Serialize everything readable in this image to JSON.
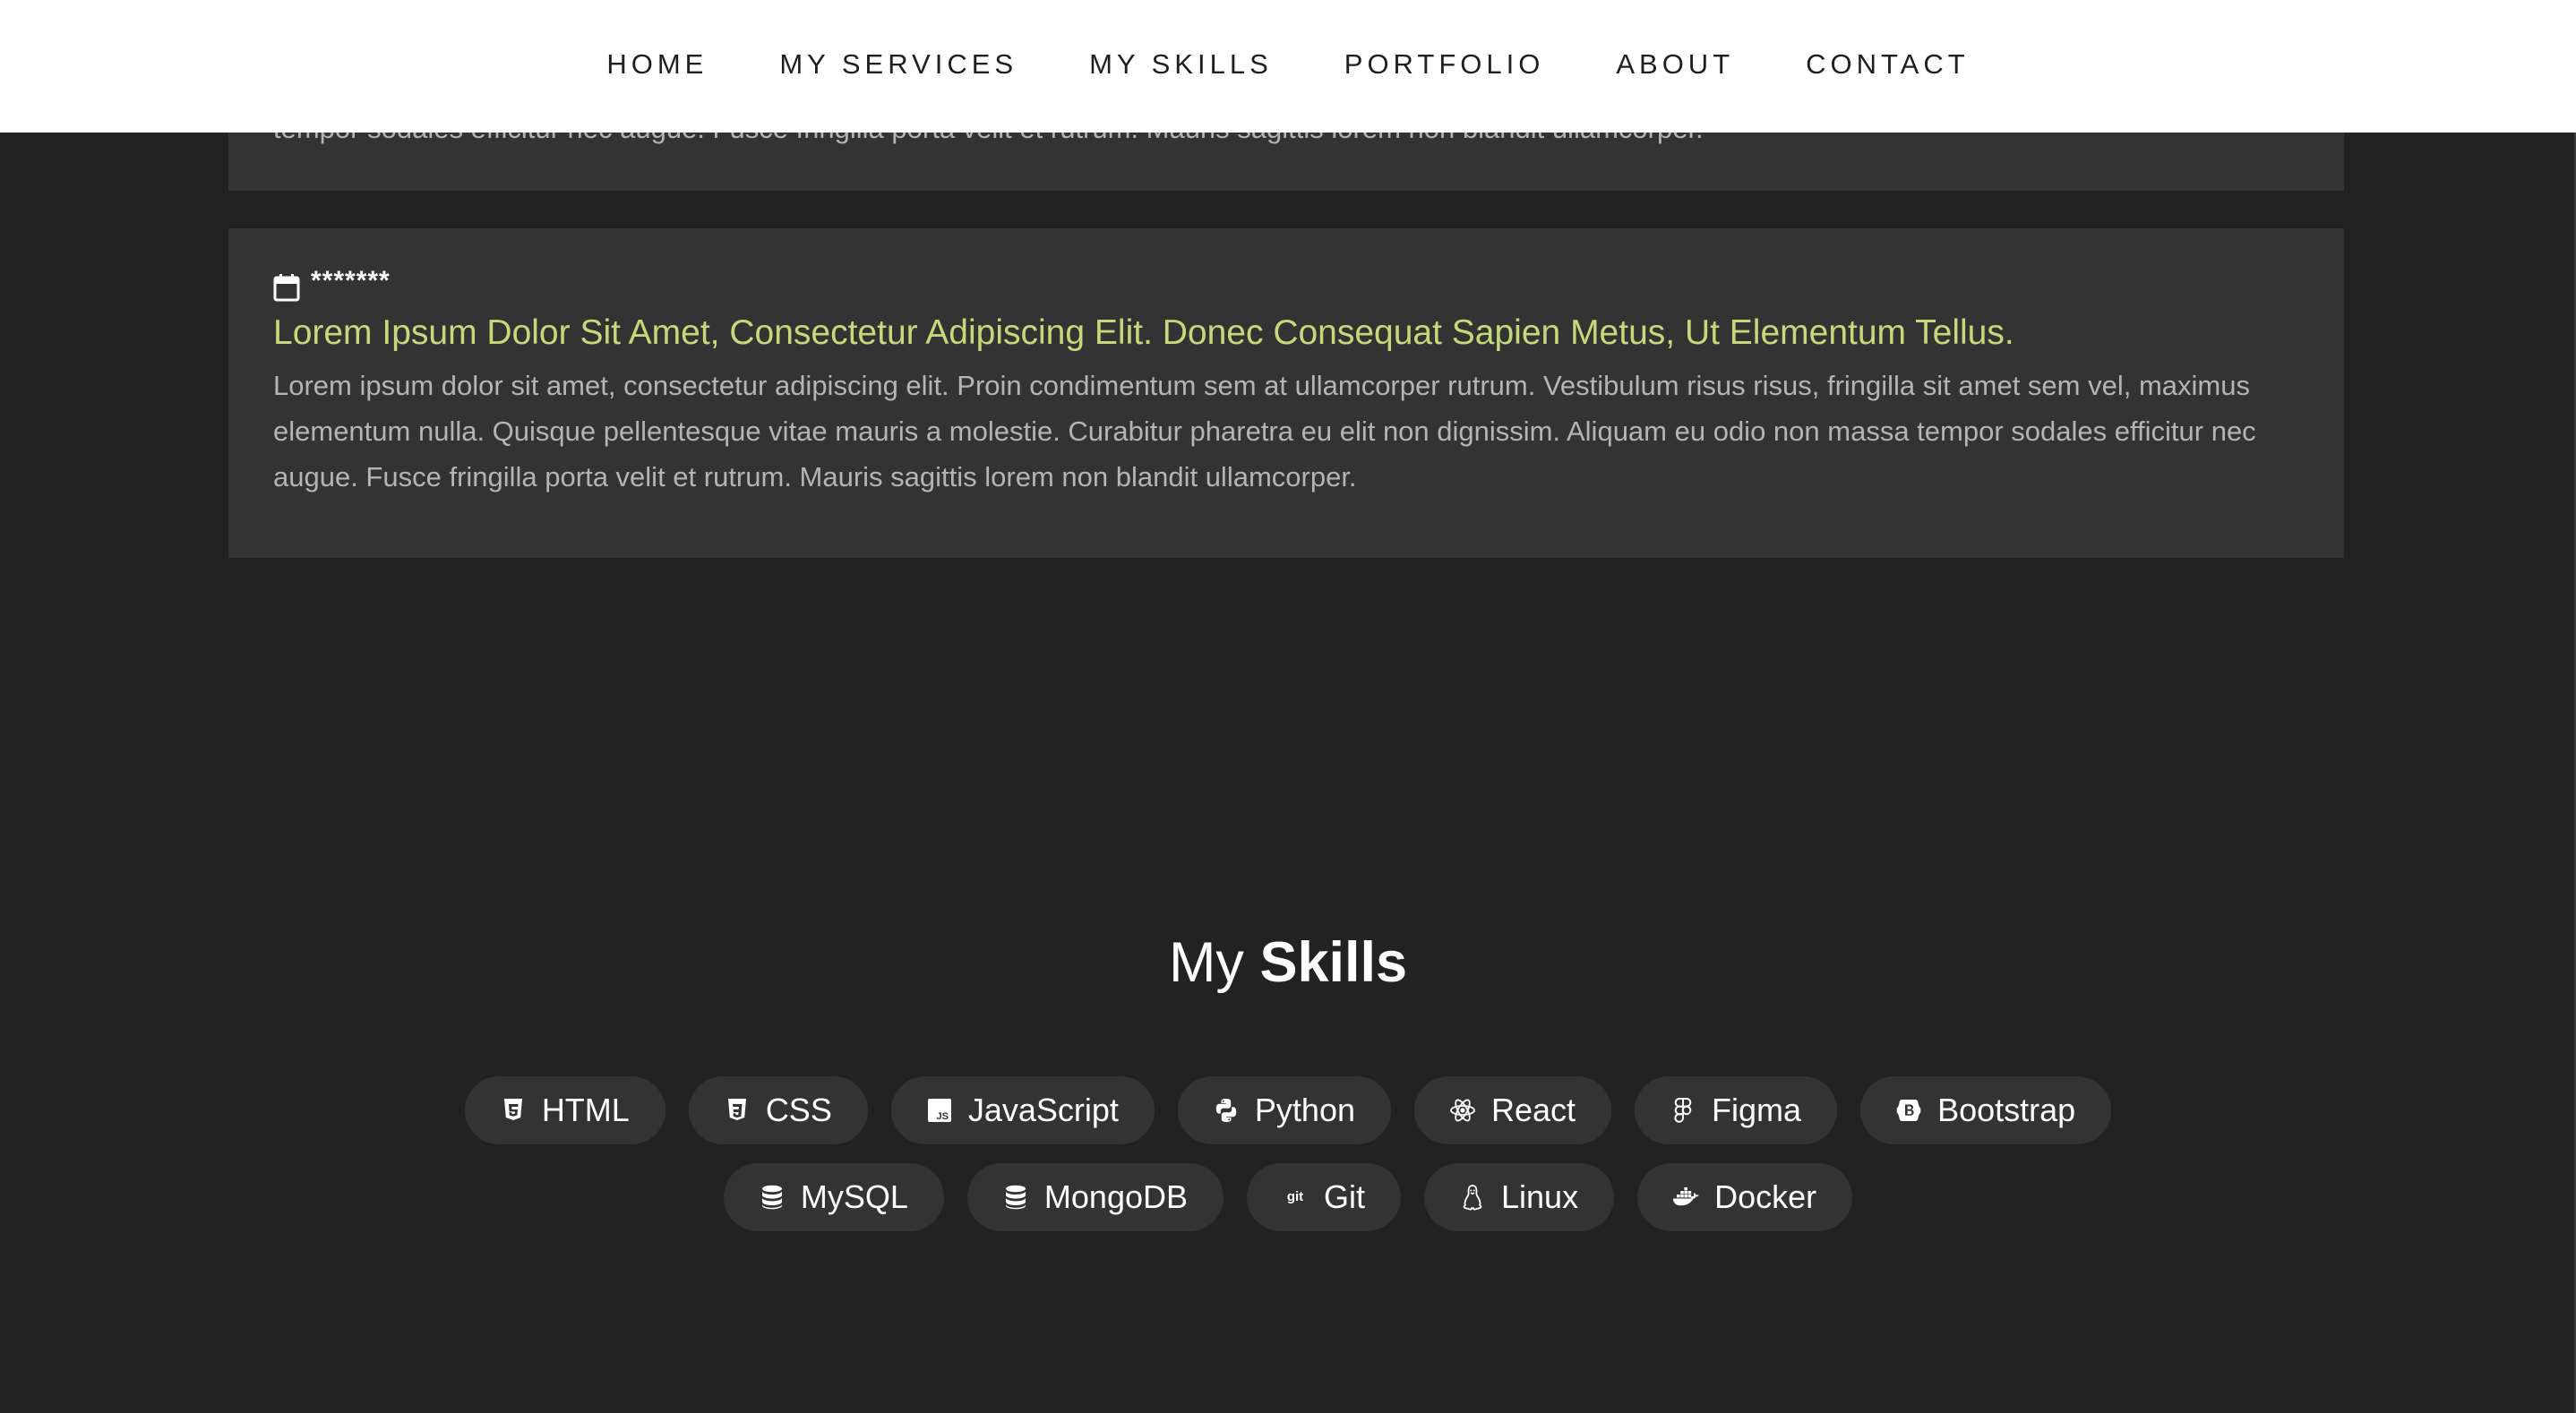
{
  "nav": {
    "items": [
      {
        "label": "HOME"
      },
      {
        "label": "MY SERVICES"
      },
      {
        "label": "MY SKILLS"
      },
      {
        "label": "PORTFOLIO"
      },
      {
        "label": "ABOUT"
      },
      {
        "label": "CONTACT"
      }
    ]
  },
  "previous_card": {
    "text": "tempor sodales efficitur nec augue. Fusce fringilla porta velit et rutrum. Mauris sagittis lorem non blandit ullamcorper."
  },
  "post_card": {
    "date": "*******",
    "title": "Lorem Ipsum Dolor Sit Amet, Consectetur Adipiscing Elit. Donec Consequat Sapien Metus, Ut Elementum Tellus.",
    "text": "Lorem ipsum dolor sit amet, consectetur adipiscing elit. Proin condimentum sem at ullamcorper rutrum. Vestibulum risus risus, fringilla sit amet sem vel, maximus elementum nulla. Quisque pellentesque vitae mauris a molestie. Curabitur pharetra eu elit non dignissim. Aliquam eu odio non massa tempor sodales efficitur nec augue. Fusce fringilla porta velit et rutrum. Mauris sagittis lorem non blandit ullamcorper."
  },
  "skills": {
    "title_light": "My",
    "title_bold": "Skills",
    "row1": [
      {
        "label": "HTML",
        "icon": "html5-icon"
      },
      {
        "label": "CSS",
        "icon": "css3-icon"
      },
      {
        "label": "JavaScript",
        "icon": "javascript-icon"
      },
      {
        "label": "Python",
        "icon": "python-icon"
      },
      {
        "label": "React",
        "icon": "react-icon"
      },
      {
        "label": "Figma",
        "icon": "figma-icon"
      },
      {
        "label": "Bootstrap",
        "icon": "bootstrap-icon"
      }
    ],
    "row2": [
      {
        "label": "MySQL",
        "icon": "database-icon"
      },
      {
        "label": "MongoDB",
        "icon": "database-icon"
      },
      {
        "label": "Git",
        "icon": "git-icon"
      },
      {
        "label": "Linux",
        "icon": "linux-icon"
      },
      {
        "label": "Docker",
        "icon": "docker-icon"
      }
    ]
  },
  "colors": {
    "page_background": "#222222",
    "card_background": "#333333",
    "accent": "#c5d97a",
    "nav_background": "#ffffff",
    "body_text": "#b4b4b4"
  }
}
